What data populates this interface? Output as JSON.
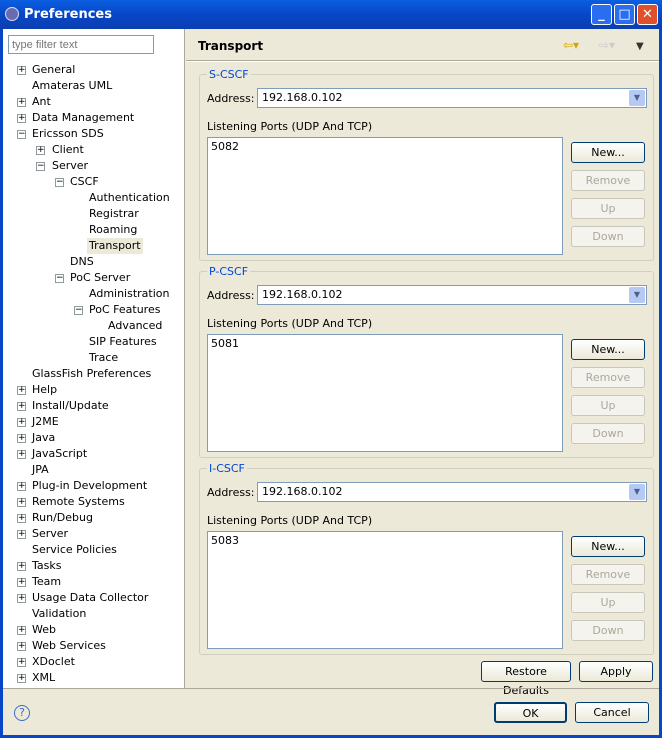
{
  "window": {
    "title": "Preferences",
    "buttons": [
      "minimize",
      "maximize",
      "close"
    ]
  },
  "filter": {
    "placeholder": "type filter text"
  },
  "tree": [
    {
      "label": "General",
      "level": 0,
      "exp": "+"
    },
    {
      "label": "Amateras UML",
      "level": 0,
      "exp": ""
    },
    {
      "label": "Ant",
      "level": 0,
      "exp": "+"
    },
    {
      "label": "Data Management",
      "level": 0,
      "exp": "+"
    },
    {
      "label": "Ericsson SDS",
      "level": 0,
      "exp": "-"
    },
    {
      "label": "Client",
      "level": 1,
      "exp": "+"
    },
    {
      "label": "Server",
      "level": 1,
      "exp": "-"
    },
    {
      "label": "CSCF",
      "level": 2,
      "exp": "-"
    },
    {
      "label": "Authentication",
      "level": 3,
      "exp": ""
    },
    {
      "label": "Registrar",
      "level": 3,
      "exp": ""
    },
    {
      "label": "Roaming",
      "level": 3,
      "exp": ""
    },
    {
      "label": "Transport",
      "level": 3,
      "exp": "",
      "selected": true
    },
    {
      "label": "DNS",
      "level": 2,
      "exp": ""
    },
    {
      "label": "PoC Server",
      "level": 2,
      "exp": "-"
    },
    {
      "label": "Administration",
      "level": 3,
      "exp": ""
    },
    {
      "label": "PoC Features",
      "level": 3,
      "exp": "-"
    },
    {
      "label": "Advanced",
      "level": 4,
      "exp": ""
    },
    {
      "label": "SIP Features",
      "level": 3,
      "exp": ""
    },
    {
      "label": "Trace",
      "level": 3,
      "exp": ""
    },
    {
      "label": "GlassFish Preferences",
      "level": 0,
      "exp": ""
    },
    {
      "label": "Help",
      "level": 0,
      "exp": "+"
    },
    {
      "label": "Install/Update",
      "level": 0,
      "exp": "+"
    },
    {
      "label": "J2ME",
      "level": 0,
      "exp": "+"
    },
    {
      "label": "Java",
      "level": 0,
      "exp": "+"
    },
    {
      "label": "JavaScript",
      "level": 0,
      "exp": "+"
    },
    {
      "label": "JPA",
      "level": 0,
      "exp": ""
    },
    {
      "label": "Plug-in Development",
      "level": 0,
      "exp": "+"
    },
    {
      "label": "Remote Systems",
      "level": 0,
      "exp": "+"
    },
    {
      "label": "Run/Debug",
      "level": 0,
      "exp": "+"
    },
    {
      "label": "Server",
      "level": 0,
      "exp": "+"
    },
    {
      "label": "Service Policies",
      "level": 0,
      "exp": ""
    },
    {
      "label": "Tasks",
      "level": 0,
      "exp": "+"
    },
    {
      "label": "Team",
      "level": 0,
      "exp": "+"
    },
    {
      "label": "Usage Data Collector",
      "level": 0,
      "exp": "+"
    },
    {
      "label": "Validation",
      "level": 0,
      "exp": ""
    },
    {
      "label": "Web",
      "level": 0,
      "exp": "+"
    },
    {
      "label": "Web Services",
      "level": 0,
      "exp": "+"
    },
    {
      "label": "XDoclet",
      "level": 0,
      "exp": "+"
    },
    {
      "label": "XML",
      "level": 0,
      "exp": "+"
    }
  ],
  "page": {
    "title": "Transport",
    "back_icon": "back-arrow-icon",
    "forward_icon": "forward-arrow-icon",
    "menu_icon": "view-menu-icon"
  },
  "groups": [
    {
      "title": "S-CSCF",
      "address_label": "Address:",
      "address": "192.168.0.102",
      "ports_label": "Listening Ports (UDP And TCP)",
      "ports": [
        "5082"
      ]
    },
    {
      "title": "P-CSCF",
      "address_label": "Address:",
      "address": "192.168.0.102",
      "ports_label": "Listening Ports (UDP And TCP)",
      "ports": [
        "5081"
      ]
    },
    {
      "title": "I-CSCF",
      "address_label": "Address:",
      "address": "192.168.0.102",
      "ports_label": "Listening Ports (UDP And TCP)",
      "ports": [
        "5083"
      ]
    }
  ],
  "group_buttons": {
    "new": "New...",
    "remove": "Remove",
    "up": "Up",
    "down": "Down"
  },
  "actions": {
    "restore": "Restore Defaults",
    "apply": "Apply",
    "ok": "OK",
    "cancel": "Cancel"
  },
  "accent": "#0846c8"
}
